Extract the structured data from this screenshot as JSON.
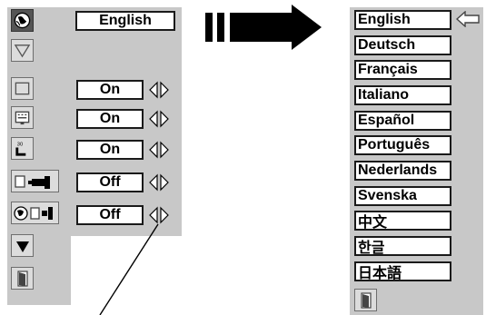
{
  "menu": {
    "selected_language": "English",
    "settings": [
      {
        "value": "On"
      },
      {
        "value": "On"
      },
      {
        "value": "On"
      },
      {
        "value": "Off"
      },
      {
        "value": "Off"
      }
    ]
  },
  "language_list": [
    "English",
    "Deutsch",
    "Français",
    "Italiano",
    "Español",
    "Português",
    "Nederlands",
    "Svenska",
    "中文",
    "한글",
    "日本語"
  ],
  "icons": [
    "globe-icon",
    "keystone-icon",
    "blackboard-icon",
    "display-icon",
    "logo-icon",
    "ceiling-icon",
    "rear-icon",
    "down-arrow-icon",
    "exit-icon"
  ],
  "colors": {
    "panel": "#c8c8c8",
    "highlight": "#555555",
    "text": "#000000"
  }
}
